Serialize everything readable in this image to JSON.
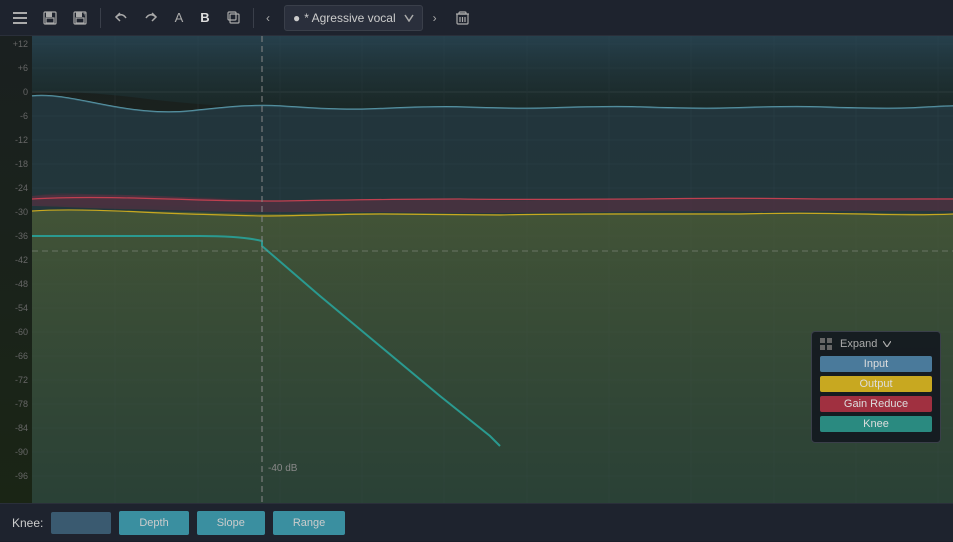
{
  "toolbar": {
    "preset_name": "* Agressive vocal",
    "buttons": {
      "menu": "☰",
      "save": "💾",
      "save_as": "📋",
      "undo": "↩",
      "redo": "↪",
      "ab_a": "A",
      "ab_b": "B",
      "copy": "⧉",
      "prev": "‹",
      "next": "›",
      "delete": "🗑"
    }
  },
  "chart": {
    "db_labels": [
      "+12",
      "+6",
      "0",
      "-6",
      "-12",
      "-18",
      "-24",
      "-30",
      "-36",
      "-42",
      "-48",
      "-54",
      "-60",
      "-66",
      "-72",
      "-78",
      "-84",
      "-90",
      "-96"
    ],
    "vert_line_db": "-40 dB",
    "horiz_line_db": "-40 dB"
  },
  "legend": {
    "expand_label": "Expand",
    "items": [
      {
        "label": "Input",
        "color": "#4a7a9b"
      },
      {
        "label": "Output",
        "color": "#c8a820"
      },
      {
        "label": "Gain Reduce",
        "color": "#a03040"
      },
      {
        "label": "Knee",
        "color": "#2a8a80"
      }
    ]
  },
  "bottom_controls": {
    "knee_label": "Knee:",
    "knee_value": "",
    "depth_label": "Depth",
    "slope_label": "Slope",
    "range_label": "Range"
  }
}
